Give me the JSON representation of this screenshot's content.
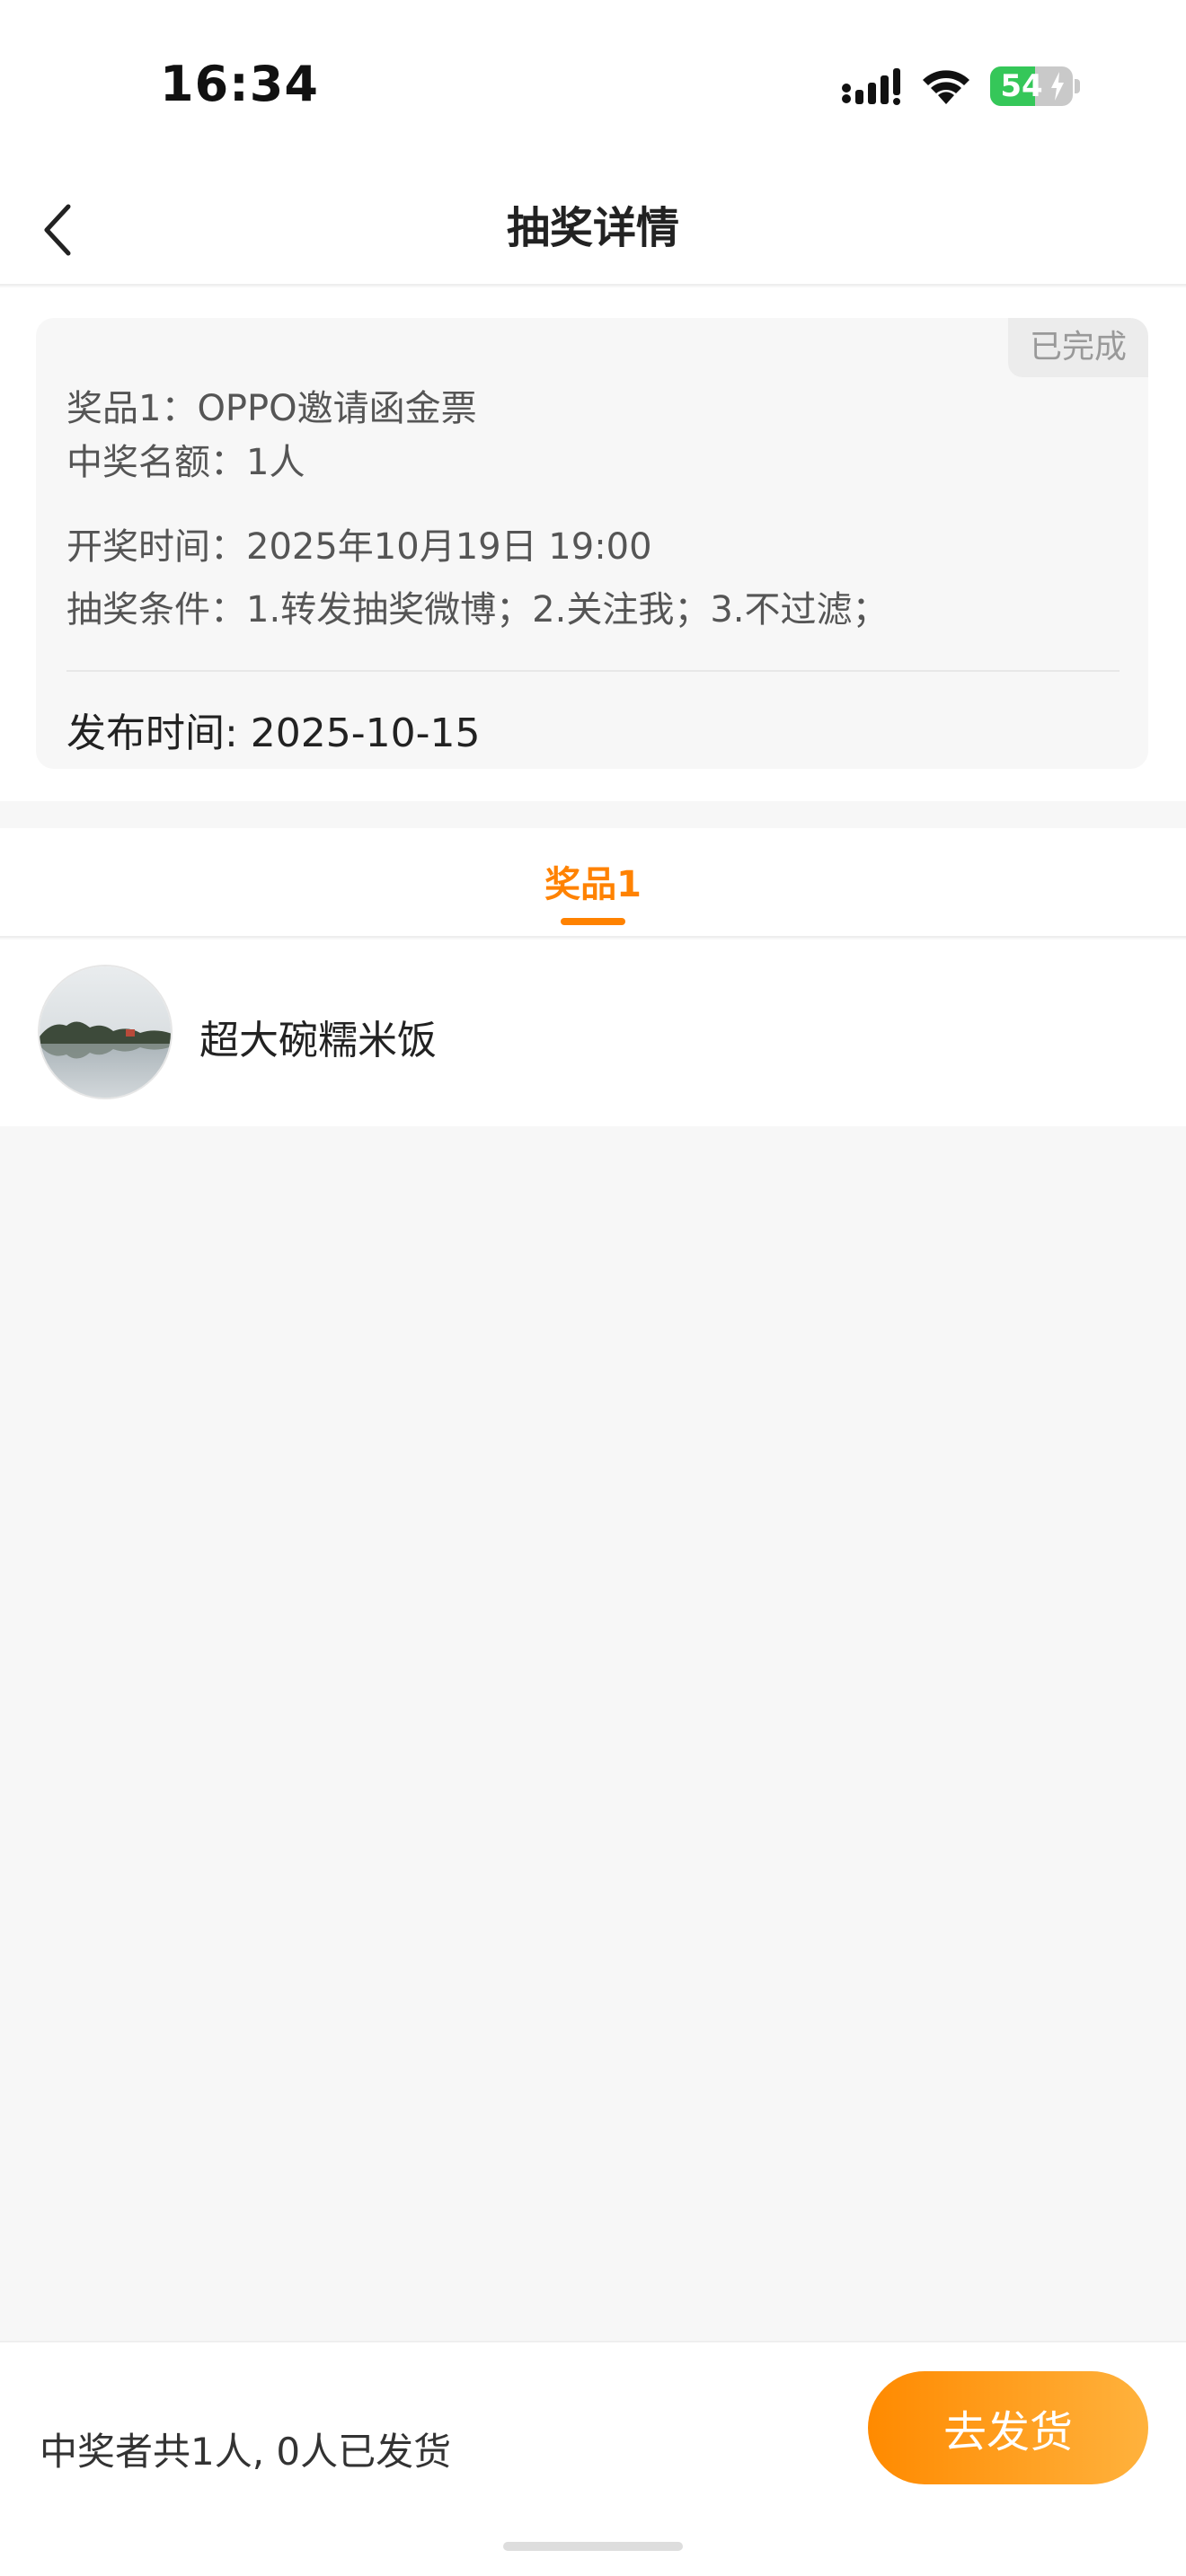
{
  "status_bar": {
    "time": "16:34",
    "battery_level": "54",
    "battery_fraction": 0.54,
    "icons": [
      "signal-icon",
      "wifi-icon",
      "battery-icon"
    ],
    "battery_color": "#35c759"
  },
  "nav": {
    "title": "抽奖详情",
    "back_icon": "chevron-left-icon"
  },
  "info": {
    "status_badge": "已完成",
    "prize_line": "奖品1：OPPO邀请函金票",
    "quota_line": "中奖名额：1人",
    "draw_time_line": "开奖时间：2025年10月19日 19:00",
    "conditions_line": "抽奖条件：1.转发抽奖微博；2.关注我；3.不过滤；",
    "publish_line": "发布时间: 2025-10-15"
  },
  "tabs": [
    {
      "label": "奖品1",
      "active": true
    }
  ],
  "winners": [
    {
      "name": "超大碗糯米饭",
      "avatar_icon": "landscape-avatar"
    }
  ],
  "bottom": {
    "summary": "中奖者共1人, 0人已发货",
    "ship_button": "去发货"
  },
  "colors": {
    "accent": "#ff8200",
    "button_gradient_start": "#ff8a00",
    "button_gradient_end": "#ffb23d",
    "background": "#f7f7f7"
  }
}
